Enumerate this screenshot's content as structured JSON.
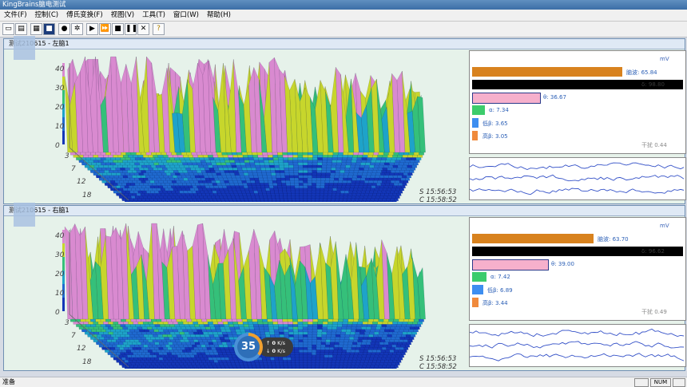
{
  "window": {
    "title": "KingBrains脑电测试"
  },
  "menu": [
    "文件(F)",
    "控制(C)",
    "傅氏变换(F)",
    "视图(V)",
    "工具(T)",
    "窗口(W)",
    "帮助(H)"
  ],
  "toolbar": {
    "icons": [
      "open-icon",
      "save-icon",
      "print-icon",
      "save-disk-icon",
      "record-icon",
      "settings-icon",
      "play-icon",
      "fast-forward-icon",
      "stop-icon",
      "pause-icon",
      "close-icon",
      "help-icon"
    ]
  },
  "panes": [
    {
      "title": "测试210615 - 左脑1",
      "z_ticks": [
        "40",
        "30",
        "20",
        "10",
        "0"
      ],
      "freq_ticks": [
        "3",
        "7",
        "12",
        "18"
      ],
      "start_time": "S 15:56:53",
      "current_time": "C 15:58:52",
      "unit": "mV",
      "bands": [
        {
          "name": "脑波",
          "value": "65.84",
          "color": "#d8821e",
          "fraction": 0.94
        },
        {
          "name": "δ",
          "value": "98.80",
          "color": "#000000",
          "fraction": 1.0
        },
        {
          "name": "θ",
          "value": "36.67",
          "color": "#f6b0cc",
          "fraction": 0.42
        },
        {
          "name": "α",
          "value": "7.34",
          "color": "#3ccc6c",
          "fraction": 0.08
        },
        {
          "name": "低β",
          "value": "3.65",
          "color": "#3d8ef0",
          "fraction": 0.04
        },
        {
          "name": "高β",
          "value": "3.05",
          "color": "#f08a3c",
          "fraction": 0.035
        }
      ],
      "extra": "干扰 0.44"
    },
    {
      "title": "测试210615 - 右脑1",
      "z_ticks": [
        "40",
        "30",
        "20",
        "10",
        "0"
      ],
      "freq_ticks": [
        "3",
        "7",
        "12",
        "18"
      ],
      "start_time": "S 15:56:53",
      "current_time": "C 15:58:52",
      "unit": "mV",
      "bands": [
        {
          "name": "脑波",
          "value": "63.70",
          "color": "#d8821e",
          "fraction": 0.76
        },
        {
          "name": "δ",
          "value": "96.62",
          "color": "#000000",
          "fraction": 1.0
        },
        {
          "name": "θ",
          "value": "39.00",
          "color": "#f6b0cc",
          "fraction": 0.47
        },
        {
          "name": "α",
          "value": "7.42",
          "color": "#3ccc6c",
          "fraction": 0.09
        },
        {
          "name": "低β",
          "value": "6.89",
          "color": "#3d8ef0",
          "fraction": 0.07
        },
        {
          "name": "高β",
          "value": "3.44",
          "color": "#f08a3c",
          "fraction": 0.04
        }
      ],
      "extra": "干扰 0.49"
    }
  ],
  "overlay": {
    "percent": "35",
    "up": "0",
    "down": "0",
    "rate_unit": "K/s"
  },
  "status": {
    "text": "准备",
    "num": "NUM"
  }
}
